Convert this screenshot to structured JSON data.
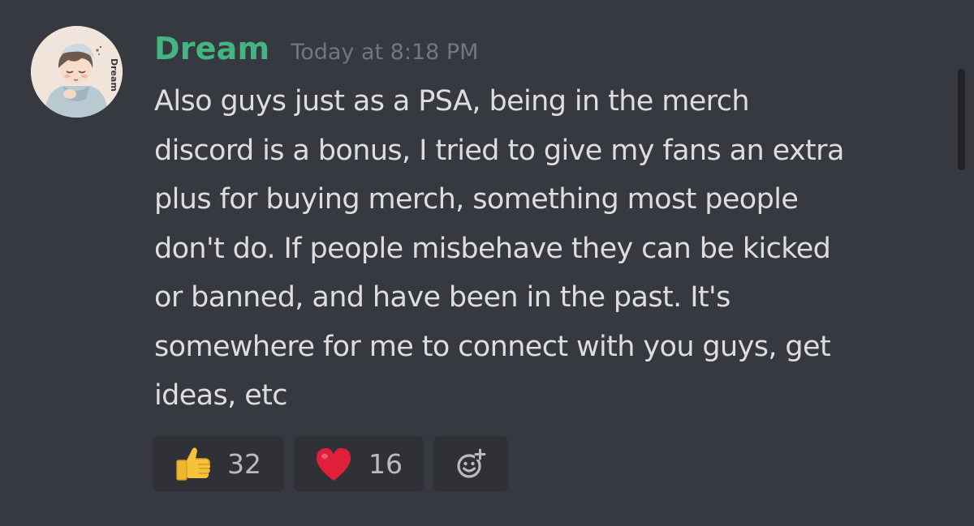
{
  "message": {
    "username": "Dream",
    "username_color": "#43b581",
    "timestamp": "Today at 8:18 PM",
    "avatar_name_tag": "Dream",
    "content_lines": [
      "Also guys just as a PSA, being in the merch",
      "discord is a bonus, I tried to give my fans an extra",
      "plus for buying merch, something most people",
      "don't do. If people misbehave they can be kicked",
      "or banned, and have been in the past. It's",
      "somewhere for me to connect with you guys, get",
      "ideas, etc"
    ]
  },
  "reactions": [
    {
      "emoji": "thumbs-up-icon",
      "count": "32"
    },
    {
      "emoji": "red-heart-icon",
      "count": "16"
    }
  ],
  "add_reaction_icon": "add-reaction-icon",
  "colors": {
    "background": "#36393f",
    "text": "#dcddde",
    "timestamp": "#72767d",
    "reaction_bg": "#2f3136"
  }
}
